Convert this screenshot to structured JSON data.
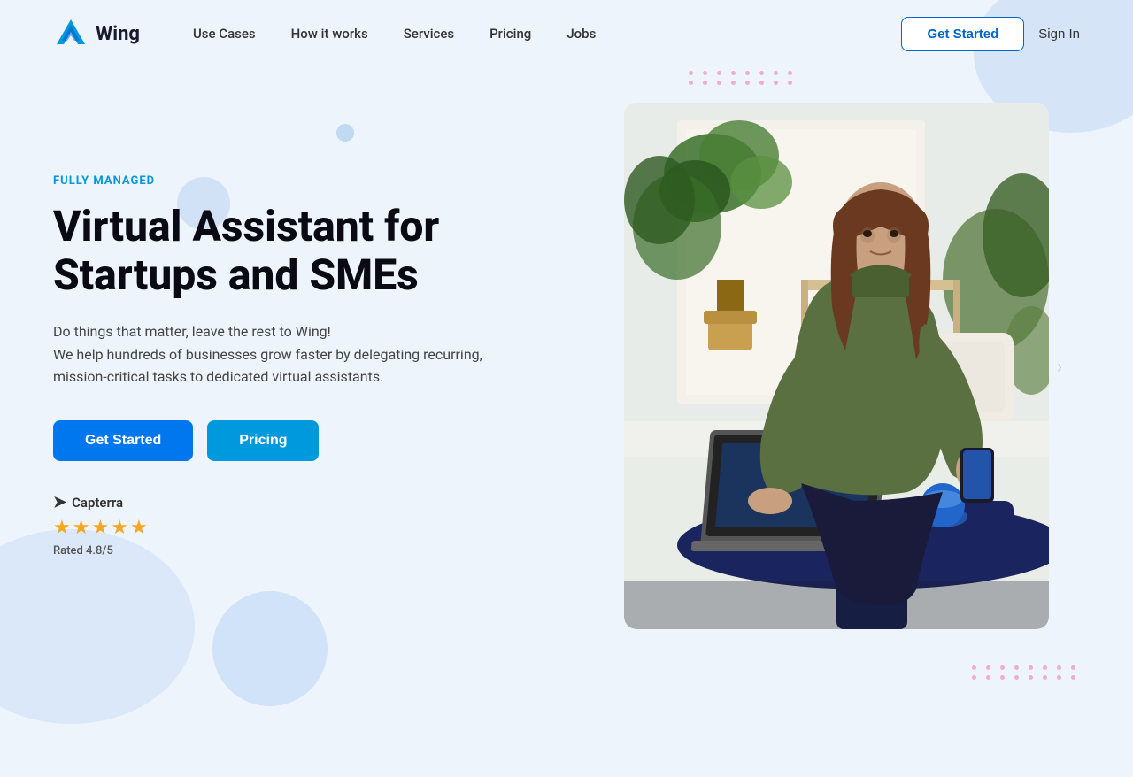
{
  "meta": {
    "title": "Wing - Virtual Assistant for Startups and SMEs"
  },
  "nav": {
    "logo_text": "Wing",
    "links": [
      {
        "label": "Use Cases",
        "id": "use-cases"
      },
      {
        "label": "How it works",
        "id": "how-it-works"
      },
      {
        "label": "Services",
        "id": "services"
      },
      {
        "label": "Pricing",
        "id": "pricing"
      },
      {
        "label": "Jobs",
        "id": "jobs"
      }
    ],
    "cta_label": "Get Started",
    "signin_label": "Sign In"
  },
  "hero": {
    "tag": "FULLY MANAGED",
    "title_line1": "Virtual Assistant for",
    "title_line2": "Startups and SMEs",
    "description_line1": "Do things that matter, leave the rest to Wing!",
    "description_line2": "We help hundreds of businesses grow faster by delegating recurring,",
    "description_line3": "mission-critical tasks to dedicated virtual assistants.",
    "btn_primary": "Get Started",
    "btn_secondary": "Pricing",
    "capterra_label": "Capterra",
    "stars_count": 5,
    "rating": "Rated 4.8/5"
  },
  "colors": {
    "accent_blue": "#0077ee",
    "accent_cyan": "#0099dd",
    "tag_color": "#00aadd",
    "star_color": "#f5a623",
    "nav_link_color": "#333333",
    "bg": "#eef4fb"
  },
  "icons": {
    "logo": "W",
    "capterra_arrow": "➤",
    "star": "★",
    "nav_arrow": "›"
  }
}
